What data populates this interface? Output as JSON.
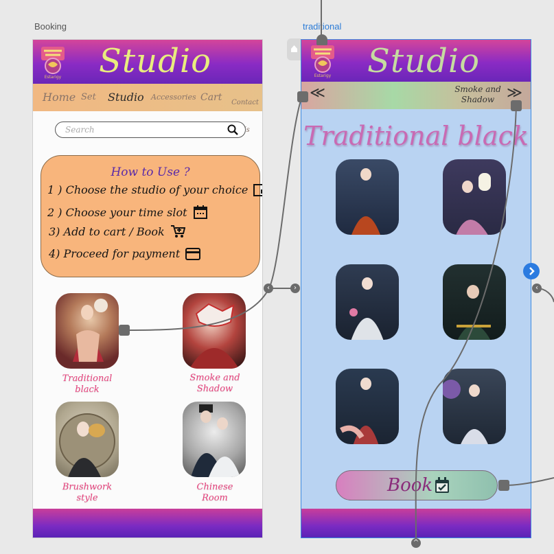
{
  "artboards": {
    "booking_label": "Booking",
    "traditional_label": "traditional"
  },
  "booking": {
    "header": {
      "title": "Studio"
    },
    "nav": {
      "home": "Home",
      "set": "Set",
      "studio": "Studio",
      "accessories": "Accessories",
      "cart": "Cart",
      "contact_line1": "Contact",
      "contact_line2": "Us"
    },
    "search": {
      "placeholder": "Search"
    },
    "howto": {
      "title": "How to Use ?",
      "steps": [
        {
          "text": "1 ) Choose the studio of your choice",
          "icon": "picture-in-picture-icon"
        },
        {
          "text": "2 ) Choose your time slot",
          "icon": "calendar-icon"
        },
        {
          "text": "3) Add to cart / Book",
          "icon": "add-cart-icon"
        },
        {
          "text": "4) Proceed for payment",
          "icon": "credit-card-icon"
        }
      ]
    },
    "studios": [
      {
        "line1": "Traditional",
        "line2": "black"
      },
      {
        "line1": "Smoke and",
        "line2": "Shadow"
      },
      {
        "line1": "Brushwork",
        "line2": "style"
      },
      {
        "line1": "Chinese",
        "line2": "Room"
      }
    ]
  },
  "traditional": {
    "header": {
      "title": "Studio"
    },
    "nav": {
      "back": "≪",
      "next": "≫",
      "next_line1": "Smoke and",
      "next_line2": "Shadow"
    },
    "title": "Traditional black",
    "book": {
      "label": "Book",
      "icon": "calendar-check-icon"
    }
  },
  "colors": {
    "header_gradient": [
      "#d4459a",
      "#6a26b8"
    ],
    "howto_bg": "#f8b57c",
    "caption": "#e8437e",
    "trad_bg": "#b9d3f2",
    "selection_blue": "#2b7bd6"
  }
}
